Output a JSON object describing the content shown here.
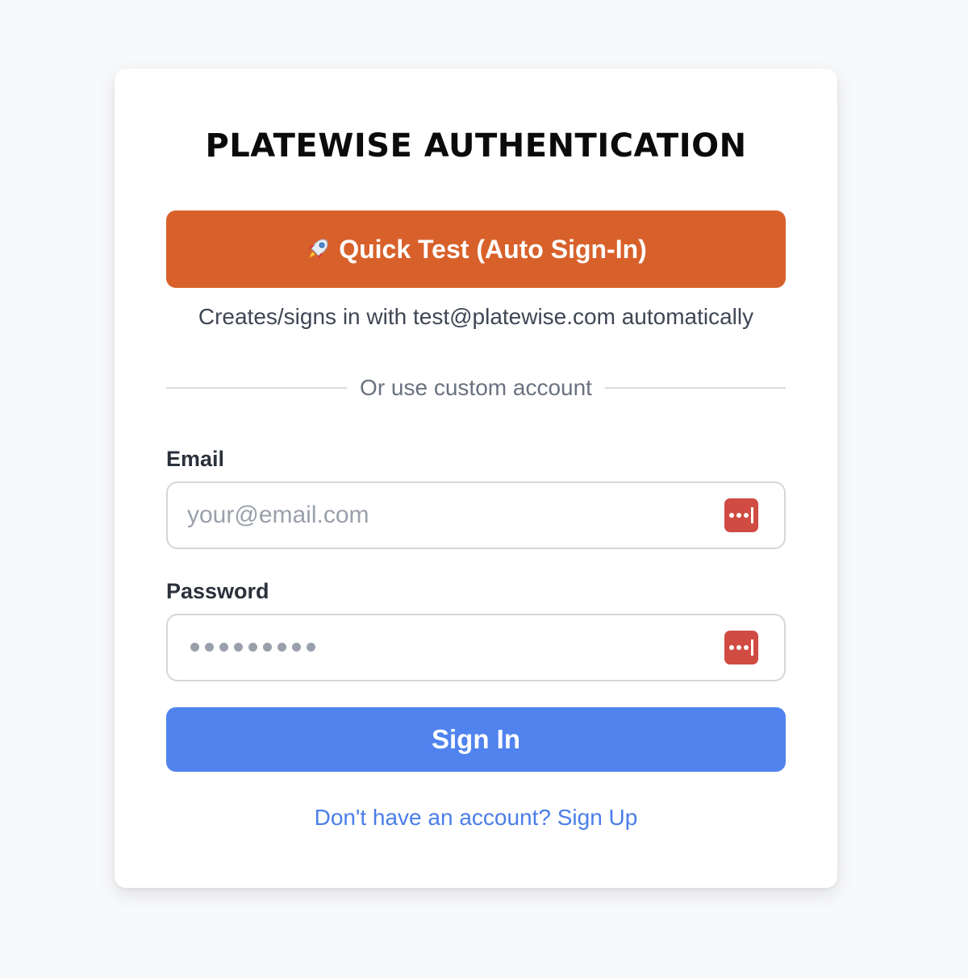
{
  "auth": {
    "title": "PLATEWISE AUTHENTICATION",
    "quick_test": {
      "icon": "rocket-icon",
      "label": "Quick Test (Auto Sign-In)",
      "color": "#d8612b",
      "helper": "Creates/signs in with test@platewise.com automatically"
    },
    "divider_text": "Or use custom account",
    "email": {
      "label": "Email",
      "placeholder": "your@email.com",
      "value": ""
    },
    "password": {
      "label": "Password",
      "placeholder": "••••••••",
      "value": ""
    },
    "password_manager_icon": "password-manager-icon",
    "sign_in_label": "Sign In",
    "sign_in_color": "#5083ee",
    "signup_link": "Don't have an account? Sign Up"
  }
}
